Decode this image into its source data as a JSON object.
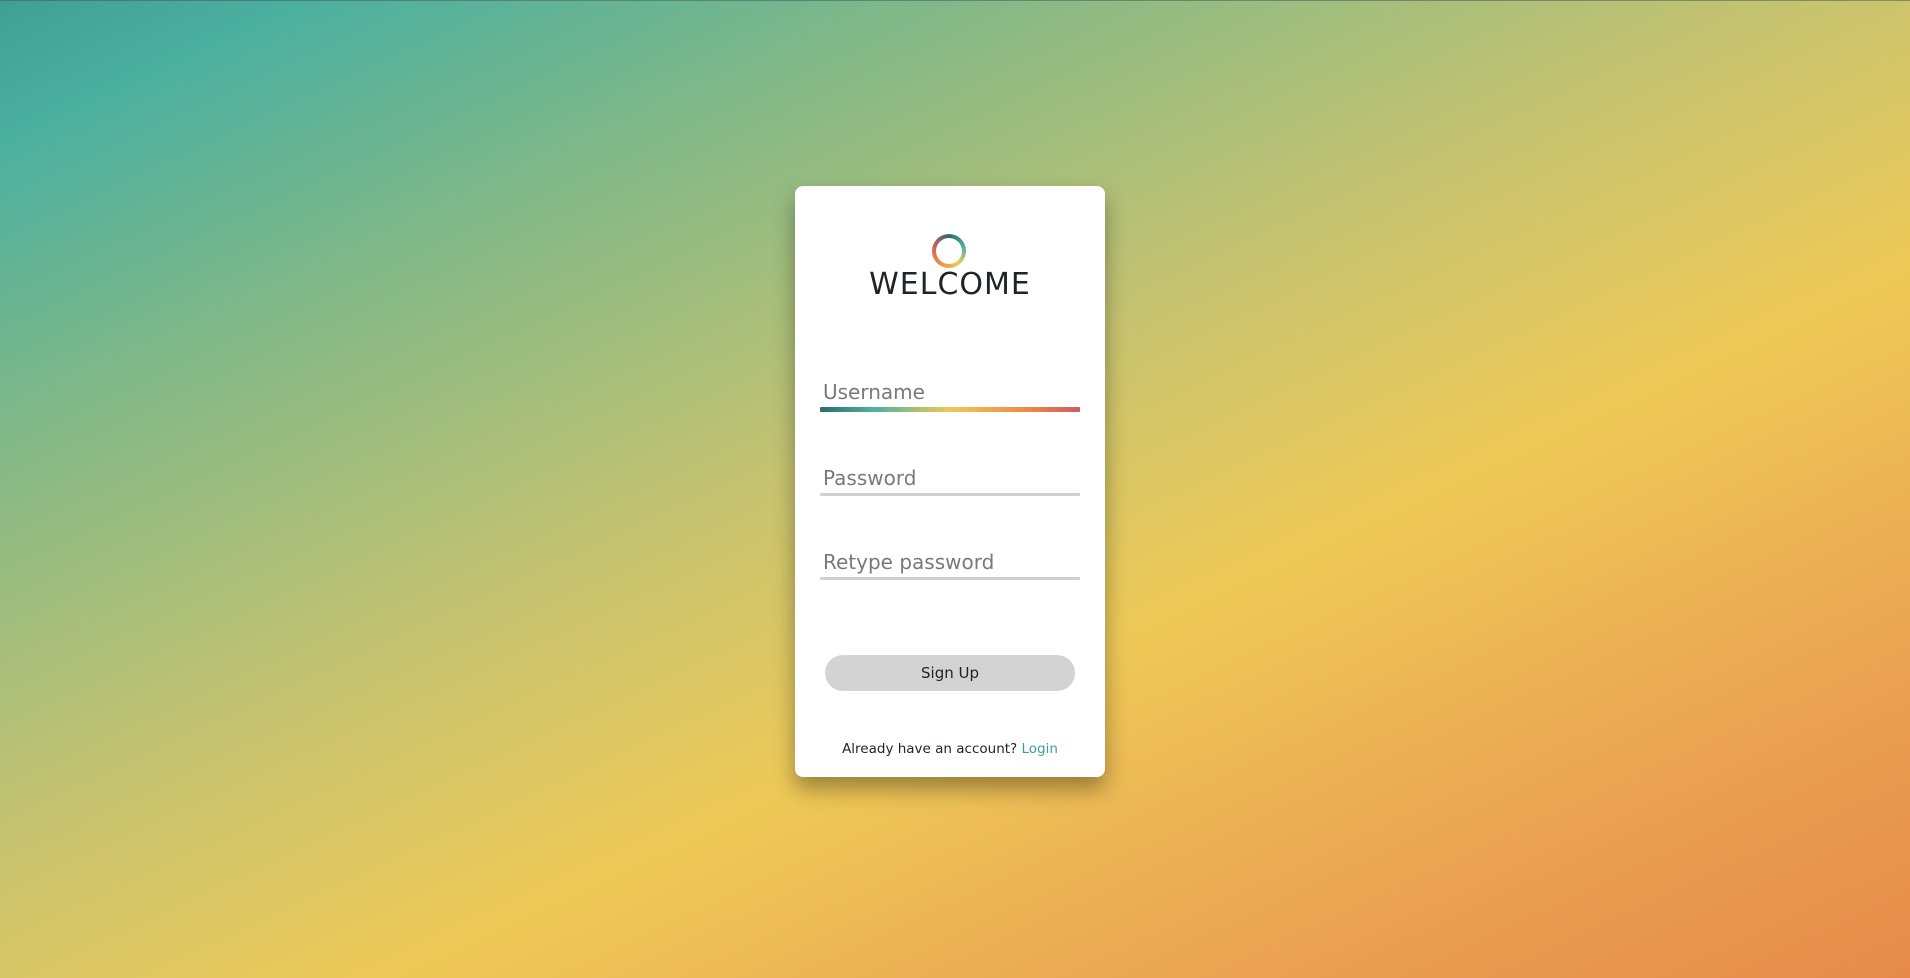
{
  "colors": {
    "accent": "#3fa090",
    "button_bg": "#d3d3d3",
    "card_bg": "#ffffff",
    "underline_inactive": "#d0d0d0",
    "background_gradient": [
      "#4cb09f",
      "#eec957",
      "#e68a4b"
    ]
  },
  "logo": {
    "icon": "ring-logo-icon"
  },
  "title": "WELCOME",
  "form": {
    "username": {
      "placeholder": "Username",
      "value": "",
      "focused": true
    },
    "password": {
      "placeholder": "Password",
      "value": ""
    },
    "retype_password": {
      "placeholder": "Retype password",
      "value": ""
    }
  },
  "signup_button": "Sign Up",
  "footer": {
    "text": "Already have an account?",
    "link": "Login"
  }
}
